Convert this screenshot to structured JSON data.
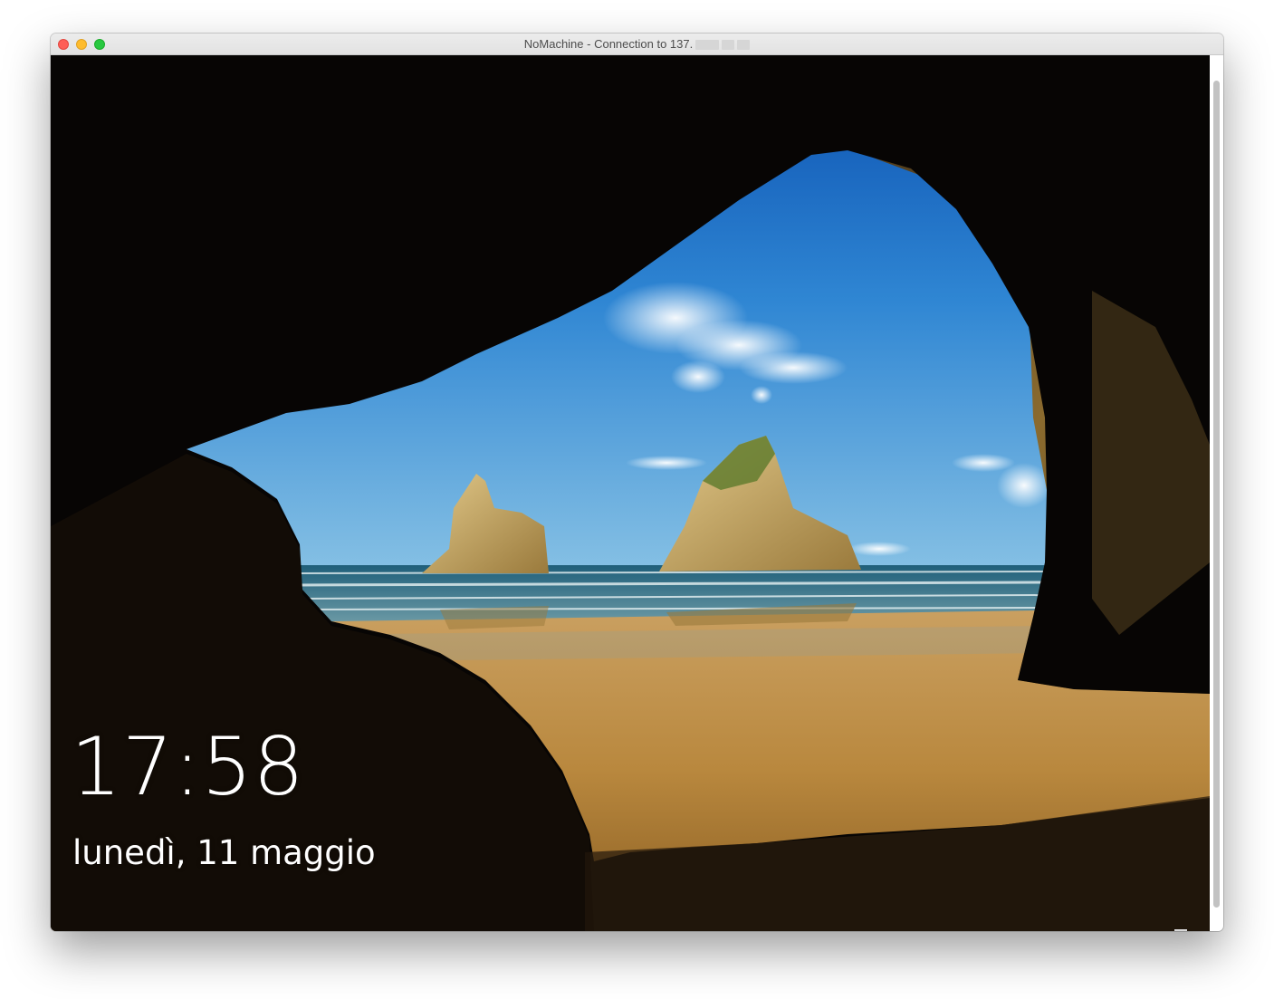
{
  "window": {
    "title": "NoMachine - Connection to 137.",
    "colors": {
      "close": "#fe5f57",
      "minimize": "#febc2e",
      "maximize": "#28c840"
    }
  },
  "lock_screen": {
    "time": "17:58",
    "date": "lunedì, 11 maggio"
  }
}
